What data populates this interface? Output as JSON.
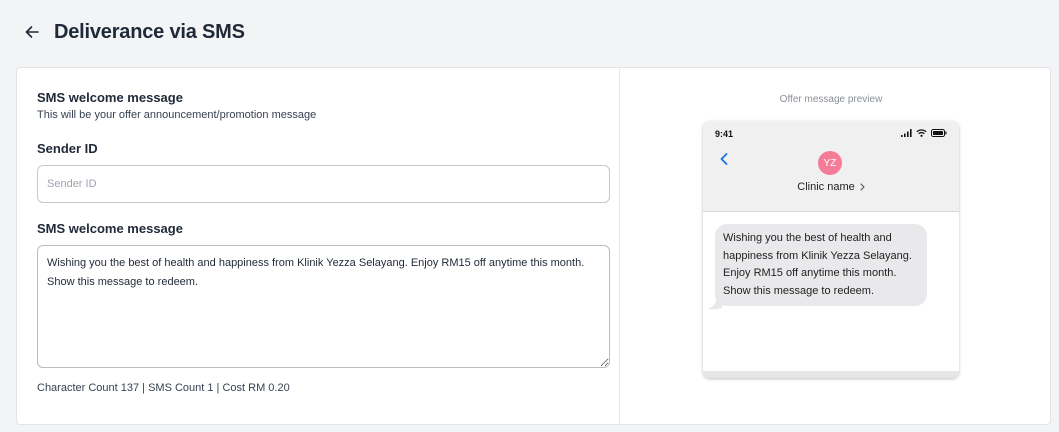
{
  "header": {
    "title": "Deliverance via SMS",
    "back_icon": "arrow-left-icon"
  },
  "form": {
    "section_title": "SMS welcome message",
    "section_subtitle": "This will be your offer announcement/promotion message",
    "sender_label": "Sender ID",
    "sender_placeholder": "Sender ID",
    "sender_value": "",
    "message_label": "SMS welcome message",
    "message_value": "Wishing you the best of health and happiness from Klinik Yezza Selayang. Enjoy RM15 off anytime this month. Show this message to redeem.",
    "count_text": "Character Count 137 | SMS Count 1 | Cost RM 0.20"
  },
  "preview": {
    "label": "Offer message preview",
    "time": "9:41",
    "avatar_initials": "YZ",
    "contact_name": "Clinic name",
    "message": "Wishing you the best of health and happiness from Klinik Yezza Selayang. Enjoy RM15 off anytime this month. Show this message to redeem.",
    "colors": {
      "avatar": "#f47c97",
      "ios_blue": "#1a73e8",
      "bubble": "#e9e9eb"
    }
  }
}
